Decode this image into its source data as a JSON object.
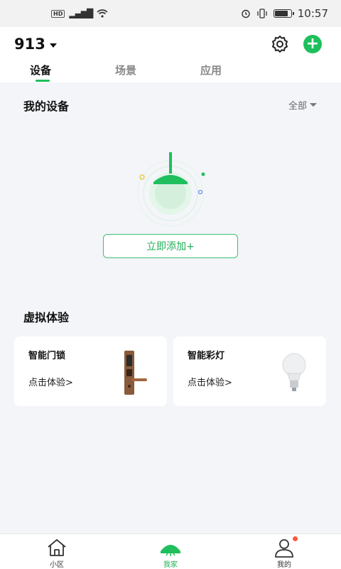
{
  "status_bar": {
    "network": "HD",
    "signal": "4G",
    "time": "10:57"
  },
  "header": {
    "home_name": "913",
    "tabs": [
      "设备",
      "场景",
      "应用"
    ],
    "active_tab": 0
  },
  "my_devices": {
    "title": "我的设备",
    "filter": "全部",
    "add_button": "立即添加+"
  },
  "virtual_experience": {
    "title": "虚拟体验",
    "cards": [
      {
        "name": "智能门锁",
        "cta": "点击体验>",
        "icon": "smart-lock-image"
      },
      {
        "name": "智能彩灯",
        "cta": "点击体验>",
        "icon": "smart-bulb-image"
      }
    ]
  },
  "bottom_nav": {
    "items": [
      {
        "label": "小区",
        "icon": "house-icon"
      },
      {
        "label": "我家",
        "icon": "home-lamp-icon"
      },
      {
        "label": "我的",
        "icon": "user-icon"
      }
    ],
    "active_index": 1
  },
  "colors": {
    "accent": "#1fbf5d",
    "background": "#f3f5f9",
    "notification_dot": "#ff5a3c"
  }
}
